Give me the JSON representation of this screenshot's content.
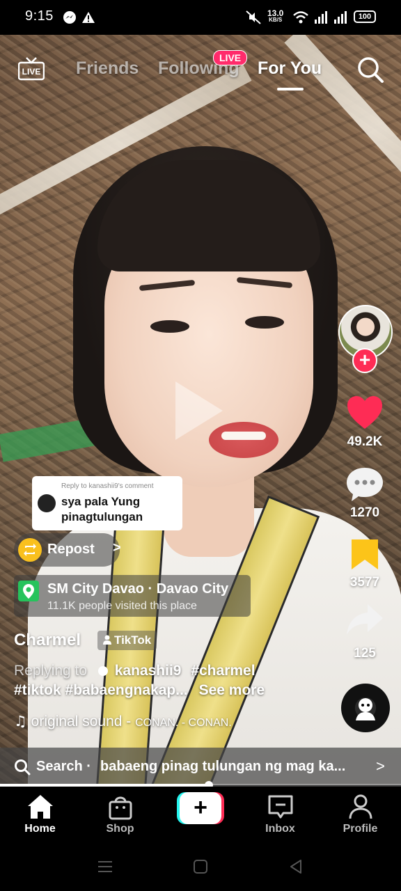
{
  "status_bar": {
    "time": "9:15",
    "icons": [
      "messenger-icon",
      "warning-icon",
      "mute-icon",
      "wifi-icon",
      "signal-icon",
      "signal-icon",
      "battery-icon"
    ],
    "net_speed_value": "13.0",
    "net_speed_unit": "KB/S",
    "battery": "100"
  },
  "top_nav": {
    "live_icon_label": "LIVE",
    "tabs": [
      {
        "label": "Friends",
        "active": false
      },
      {
        "label": "Following",
        "active": false
      },
      {
        "label": "For You",
        "active": true
      }
    ],
    "live_badge": "LIVE"
  },
  "video": {
    "colors": {
      "like": "#fe2c55",
      "favorite": "#fcc419",
      "accent_cyan": "#25f4ee"
    }
  },
  "actions": {
    "likes": "49.2K",
    "comments": "1270",
    "favorites": "3577",
    "shares": "125",
    "follow_symbol": "+"
  },
  "reply_sticker": {
    "label": "Reply to kanashii9's comment",
    "text": "sya pala Yung pinagtulungan"
  },
  "repost": {
    "label": "Repost",
    "chevron": ">"
  },
  "location": {
    "name": "SM City Davao · Davao City",
    "visits": "11.1K people visited this place"
  },
  "caption": {
    "username": "Charmel",
    "tag": "TikTok",
    "replying_prefix": "Replying to",
    "replying_user": "kanashii9",
    "hashtag1": "#charmel",
    "line2": "#tiktok #babaengnakap...",
    "see_more": "See more",
    "sound_name": "original sound -",
    "sound_artist": "CONAN. - CONAN."
  },
  "search_bar": {
    "prefix": "Search ·",
    "query": "babaeng pinag tulungan ng mag ka...",
    "chevron": ">"
  },
  "playback": {
    "progress": 0.52
  },
  "bottom_nav": {
    "home": "Home",
    "shop": "Shop",
    "create": "+",
    "inbox": "Inbox",
    "profile": "Profile"
  }
}
